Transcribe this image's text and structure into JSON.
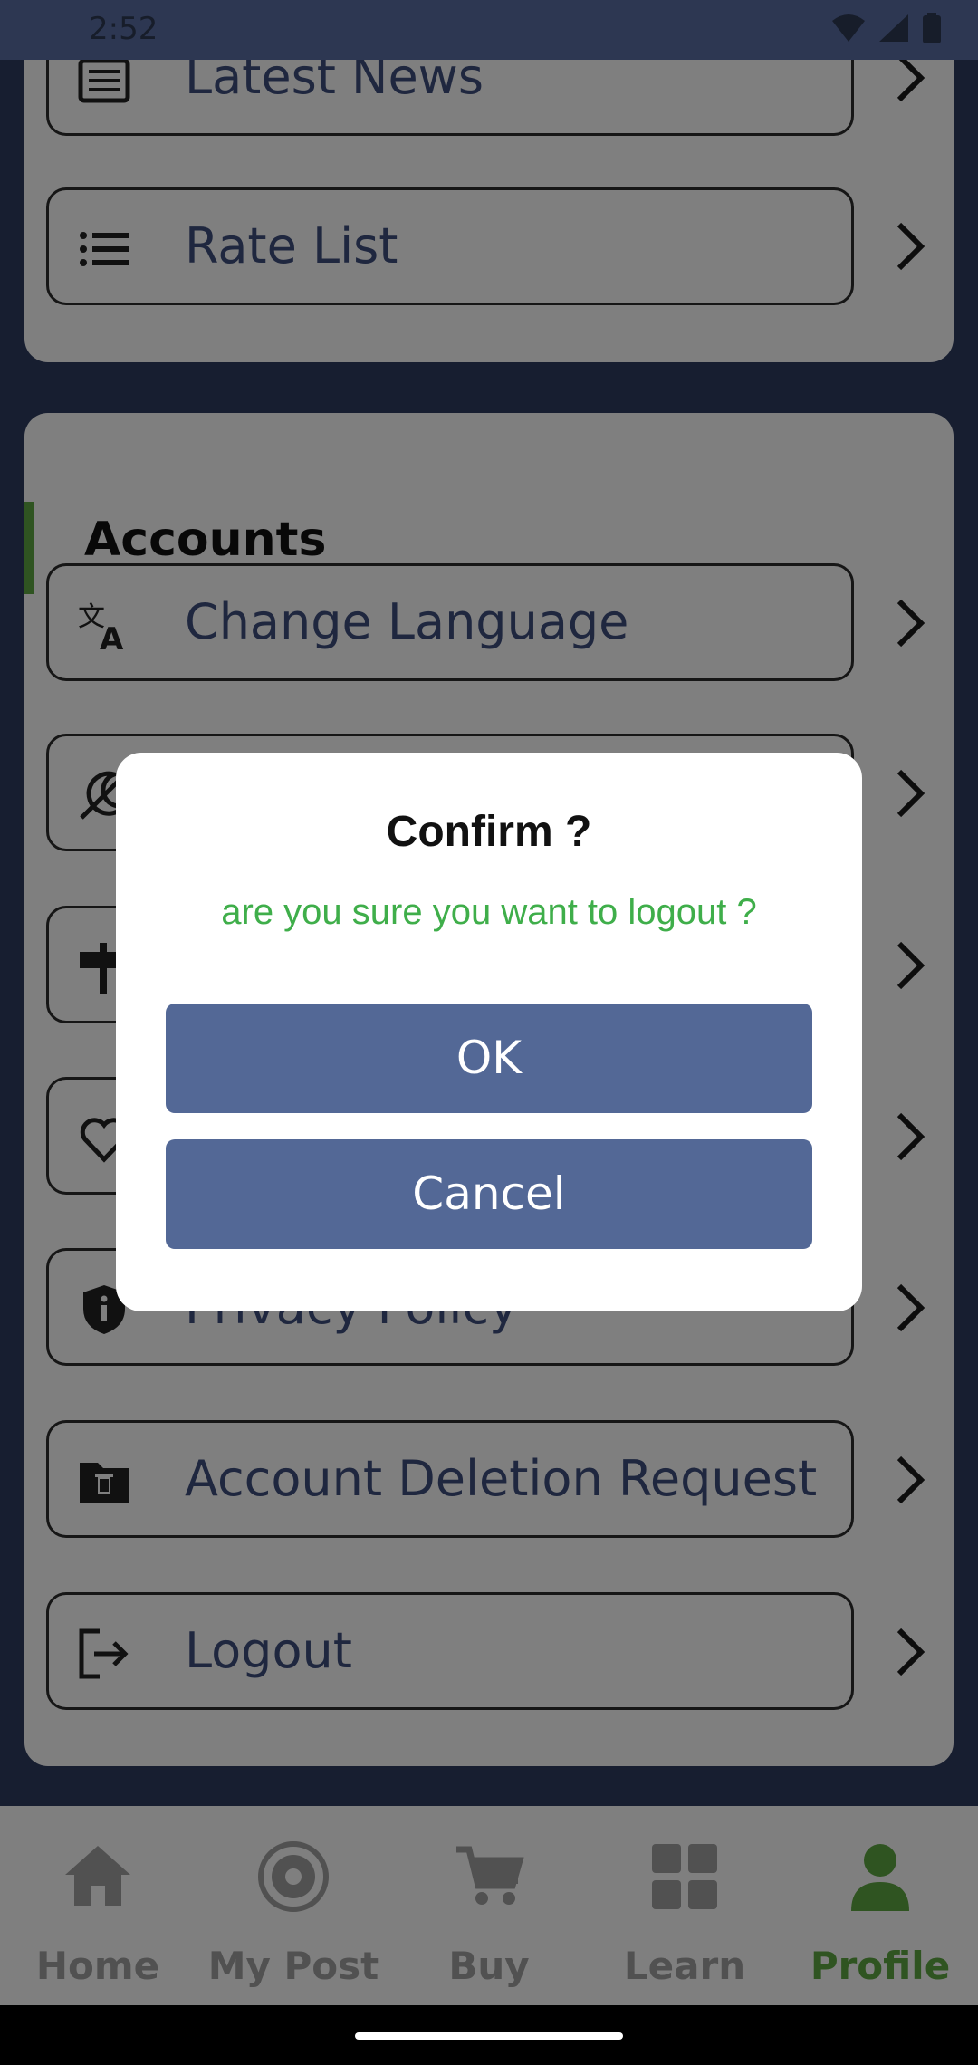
{
  "status": {
    "time": "2:52",
    "icons": [
      "wifi-icon",
      "signal-icon",
      "battery-icon"
    ]
  },
  "top_card": {
    "items": [
      {
        "label": "Latest News",
        "icon": "news-icon"
      },
      {
        "label": "Rate List",
        "icon": "list-icon"
      }
    ]
  },
  "accounts": {
    "title": "Accounts",
    "items": [
      {
        "label": "Change Language",
        "icon": "translate-icon"
      },
      {
        "label": "",
        "icon": "theme-icon"
      },
      {
        "label": "",
        "icon": "signpost-icon"
      },
      {
        "label": "",
        "icon": "heart-hand-icon"
      },
      {
        "label": "Privacy Policy",
        "icon": "shield-info-icon"
      },
      {
        "label": "Account Deletion Request",
        "icon": "folder-delete-icon"
      },
      {
        "label": "Logout",
        "icon": "logout-icon"
      }
    ]
  },
  "bottom_nav": {
    "items": [
      {
        "label": "Home",
        "icon": "home-icon",
        "active": false
      },
      {
        "label": "My Post",
        "icon": "post-icon",
        "active": false
      },
      {
        "label": "Buy",
        "icon": "cart-icon",
        "active": false
      },
      {
        "label": "Learn",
        "icon": "grid-icon",
        "active": false
      },
      {
        "label": "Profile",
        "icon": "person-icon",
        "active": true
      }
    ]
  },
  "dialog": {
    "title": "Confirm ?",
    "message": "are you sure you want to logout ?",
    "ok_label": "OK",
    "cancel_label": "Cancel"
  },
  "colors": {
    "accent_green": "#5fa842",
    "button_blue": "#536896",
    "status_bar": "#5b6fa5",
    "label_blue": "#3f4f7e"
  }
}
